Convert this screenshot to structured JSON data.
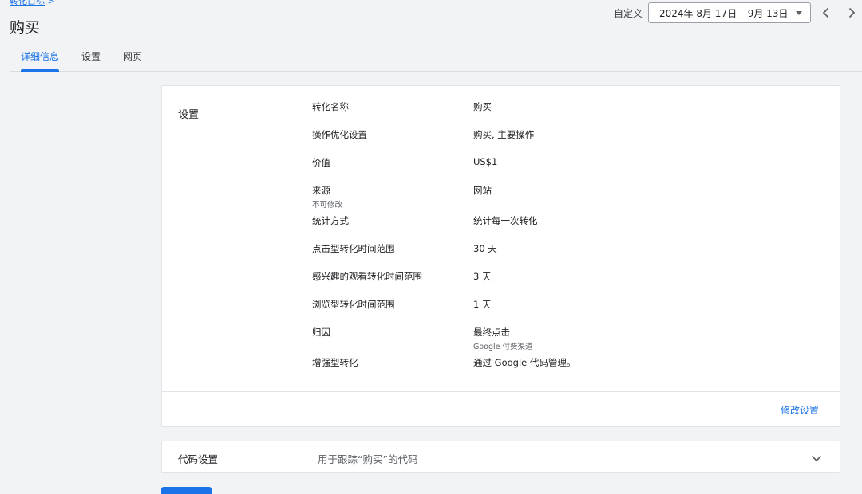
{
  "breadcrumb": {
    "crumb": "转化目标",
    "separator": ">"
  },
  "page_title": "购买",
  "date_range": {
    "label": "自定义",
    "value": "2024年 8月 17日 – 9月 13日"
  },
  "tabs": [
    {
      "label": "详细信息",
      "active": true
    },
    {
      "label": "设置",
      "active": false
    },
    {
      "label": "网页",
      "active": false
    }
  ],
  "settings": {
    "section_title": "设置",
    "rows": [
      {
        "label": "转化名称",
        "value": "购买"
      },
      {
        "label": "操作优化设置",
        "value": "购买, 主要操作"
      },
      {
        "label": "价值",
        "value": "US$1"
      },
      {
        "label": "来源",
        "label_sub": "不可修改",
        "value": "网站"
      },
      {
        "label": "统计方式",
        "value": "统计每一次转化"
      },
      {
        "label": "点击型转化时间范围",
        "value": "30 天"
      },
      {
        "label": "感兴趣的观看转化时间范围",
        "value": "3 天"
      },
      {
        "label": "浏览型转化时间范围",
        "value": "1 天"
      },
      {
        "label": "归因",
        "value": "最终点击",
        "value_sub": "Google 付费渠道"
      },
      {
        "label": "增强型转化",
        "value": "通过 Google 代码管理。"
      }
    ],
    "edit_label": "修改设置"
  },
  "code_settings": {
    "title": "代码设置",
    "description": "用于跟踪“购买”的代码"
  },
  "colors": {
    "accent": "#1a73e8",
    "background": "#f1f3f4",
    "card": "#ffffff"
  },
  "icons": {
    "prev": "chevron-left-icon",
    "next": "chevron-right-icon",
    "dropdown": "caret-down-icon",
    "expand": "chevron-down-icon"
  }
}
